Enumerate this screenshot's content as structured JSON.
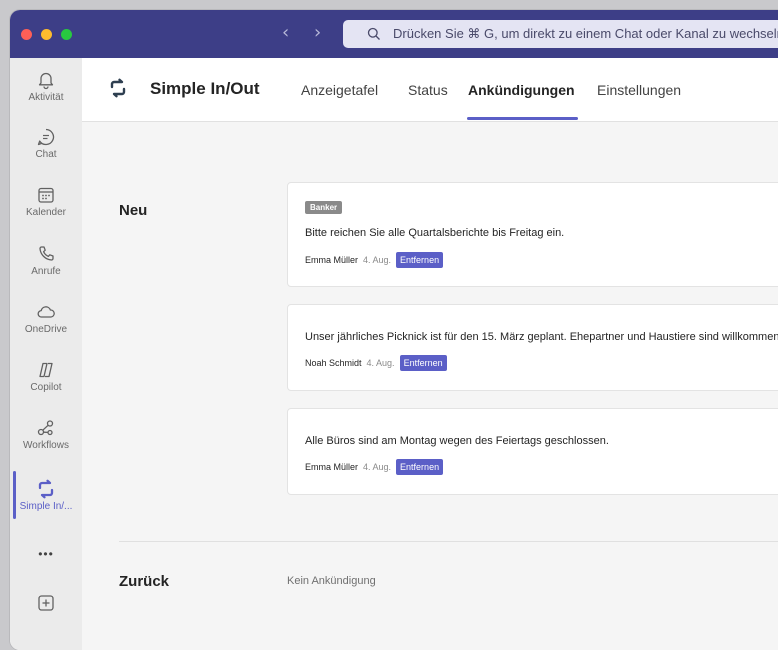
{
  "search": {
    "placeholder": "Drücken Sie ⌘ G, um direkt zu einem Chat oder Kanal zu wechseln"
  },
  "rail": {
    "items": [
      {
        "label": "Aktivität",
        "icon": "bell-icon"
      },
      {
        "label": "Chat",
        "icon": "chat-icon"
      },
      {
        "label": "Kalender",
        "icon": "calendar-icon"
      },
      {
        "label": "Anrufe",
        "icon": "phone-icon"
      },
      {
        "label": "OneDrive",
        "icon": "cloud-icon"
      },
      {
        "label": "Copilot",
        "icon": "copilot-icon"
      },
      {
        "label": "Workflows",
        "icon": "workflows-icon"
      },
      {
        "label": "Simple In/...",
        "icon": "simple-inout-icon"
      }
    ],
    "more": "•••",
    "add_icon": "add-apps-icon"
  },
  "app": {
    "title": "Simple In/Out",
    "tabs": [
      {
        "label": "Anzeigetafel"
      },
      {
        "label": "Status"
      },
      {
        "label": "Ankündigungen",
        "active": true
      },
      {
        "label": "Einstellungen"
      }
    ]
  },
  "sections": {
    "new_label": "Neu",
    "back_label": "Zurück",
    "empty_text": "Kein Ankündigung"
  },
  "announcements": [
    {
      "tag": "Banker",
      "text": "Bitte reichen Sie alle Quartalsberichte bis Freitag ein.",
      "author": "Emma Müller",
      "date": "4. Aug.",
      "button": "Entfernen"
    },
    {
      "text": "Unser jährliches Picknick ist für den 15. März geplant. Ehepartner und Haustiere sind willkommen!",
      "author": "Noah Schmidt",
      "date": "4. Aug.",
      "button": "Entfernen"
    },
    {
      "text": "Alle Büros sind am Montag wegen des Feiertags geschlossen.",
      "author": "Emma Müller",
      "date": "4. Aug.",
      "button": "Entfernen"
    }
  ],
  "colors": {
    "titlebar": "#3d3e87",
    "accent": "#5b5fc7"
  }
}
